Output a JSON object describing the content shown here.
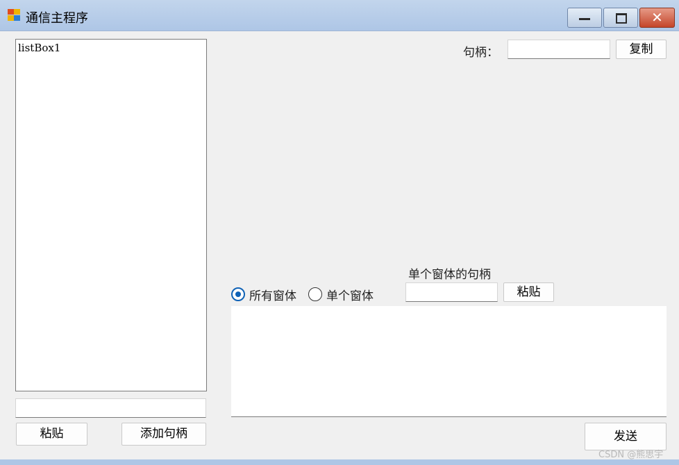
{
  "window": {
    "title": "通信主程序",
    "minimize_icon": "minimize-icon",
    "maximize_icon": "maximize-icon",
    "close_icon": "close-icon",
    "close_glyph": "✕",
    "close_color": "#c4452a"
  },
  "left": {
    "listbox_items": [
      "listBox1"
    ],
    "handle_input_value": "",
    "paste_button": "粘贴",
    "add_handle_button": "添加句柄"
  },
  "top_right": {
    "handle_label": "句柄：",
    "handle_value": "",
    "copy_button": "复制"
  },
  "target": {
    "single_handle_label": "单个窗体的句柄",
    "radio_all": "所有窗体",
    "radio_single": "单个窗体",
    "selected": "所有窗体",
    "single_handle_value": "",
    "paste_button": "粘贴"
  },
  "message": {
    "value": "",
    "send_button": "发送"
  },
  "watermark": "CSDN @熊思宇",
  "colors": {
    "accent": "#0f62b6",
    "titlebar": "#b7cde8",
    "background": "#f0f0f0"
  }
}
